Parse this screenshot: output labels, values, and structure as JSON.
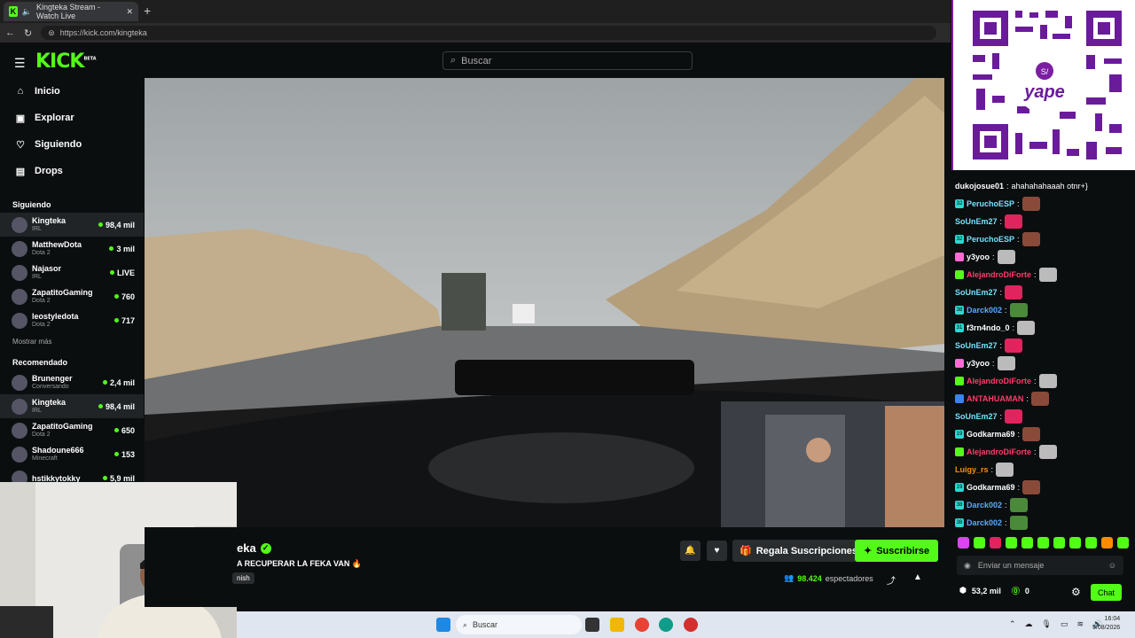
{
  "browser": {
    "tab_title": "Kingteka Stream - Watch Live",
    "url": "https://kick.com/kingteka",
    "new_tab": "+"
  },
  "header": {
    "logo": "KICK",
    "logo_badge": "BETA",
    "search_placeholder": "Buscar"
  },
  "sidebar": {
    "nav": [
      {
        "label": "Inicio",
        "icon": "home-icon"
      },
      {
        "label": "Explorar",
        "icon": "compass-icon"
      },
      {
        "label": "Siguiendo",
        "icon": "heart-icon"
      },
      {
        "label": "Drops",
        "icon": "drops-icon"
      }
    ],
    "following_title": "Siguiendo",
    "following": [
      {
        "name": "Kingteka",
        "category": "IRL",
        "viewers": "98,4 mil",
        "active": true
      },
      {
        "name": "MatthewDota",
        "category": "Dota 2",
        "viewers": "3 mil"
      },
      {
        "name": "Najasor",
        "category": "IRL",
        "viewers": "LIVE"
      },
      {
        "name": "ZapatitoGaming",
        "category": "Dota 2",
        "viewers": "760"
      },
      {
        "name": "leostyledota",
        "category": "Dota 2",
        "viewers": "717"
      }
    ],
    "show_more": "Mostrar más",
    "recommended_title": "Recomendado",
    "recommended": [
      {
        "name": "Brunenger",
        "category": "Conversando",
        "viewers": "2,4 mil"
      },
      {
        "name": "Kingteka",
        "category": "IRL",
        "viewers": "98,4 mil",
        "active": true
      },
      {
        "name": "ZapatitoGaming",
        "category": "Dota 2",
        "viewers": "650"
      },
      {
        "name": "Shadoune666",
        "category": "Minecraft",
        "viewers": "153"
      },
      {
        "name": "hstikkytokky",
        "category": "",
        "viewers": "5,9 mil"
      }
    ]
  },
  "stream": {
    "channel_name": "eka",
    "title": "A RECUPERAR LA FEKA VAN 🔥",
    "language_tag": "nish",
    "gift_label": "Regala Suscripciones",
    "subscribe_label": "Suscribirse",
    "viewers_count": "98.424",
    "viewers_label": "espectadores"
  },
  "chat": {
    "messages": [
      {
        "user": "dukojosue01",
        "text": "ahahahahaaah otnr+}",
        "color": "#ffffff",
        "badge": "",
        "emote": ""
      },
      {
        "user": "PeruchoESP",
        "text": "",
        "color": "#72e3ff",
        "badge": "32",
        "emote": "#8a4a3a"
      },
      {
        "user": "SoUnEm27",
        "text": "",
        "color": "#72e3ff",
        "badge": "",
        "emote": "#e0245e"
      },
      {
        "user": "PeruchoESP",
        "text": "",
        "color": "#72e3ff",
        "badge": "32",
        "emote": "#8a4a3a"
      },
      {
        "user": "y3yoo",
        "text": "",
        "color": "#ffffff",
        "badge": "pink",
        "emote": "#bbbbbb"
      },
      {
        "user": "AlejandroDiForte",
        "text": "",
        "color": "#ff3b6a",
        "badge": "green",
        "emote": "#bbbbbb"
      },
      {
        "user": "SoUnEm27",
        "text": "",
        "color": "#72e3ff",
        "badge": "",
        "emote": "#e0245e"
      },
      {
        "user": "Darck002",
        "text": "",
        "color": "#5aa9ff",
        "badge": "38",
        "emote": "#4a8a3a"
      },
      {
        "user": "f3rn4ndo_0",
        "text": "",
        "color": "#ffffff",
        "badge": "31",
        "emote": "#bbbbbb"
      },
      {
        "user": "SoUnEm27",
        "text": "",
        "color": "#72e3ff",
        "badge": "",
        "emote": "#e0245e"
      },
      {
        "user": "y3yoo",
        "text": "",
        "color": "#ffffff",
        "badge": "pink",
        "emote": "#bbbbbb"
      },
      {
        "user": "AlejandroDiForte",
        "text": "",
        "color": "#ff3b6a",
        "badge": "green",
        "emote": "#bbbbbb"
      },
      {
        "user": "ANTAHUAMAN",
        "text": "",
        "color": "#ff3b6a",
        "badge": "blue",
        "emote": "#8a4a3a"
      },
      {
        "user": "SoUnEm27",
        "text": "",
        "color": "#72e3ff",
        "badge": "",
        "emote": "#e0245e"
      },
      {
        "user": "Godkarma69",
        "text": "",
        "color": "#ffffff",
        "badge": "19",
        "emote": "#8a4a3a"
      },
      {
        "user": "AlejandroDiForte",
        "text": "",
        "color": "#ff3b6a",
        "badge": "green",
        "emote": "#bbbbbb"
      },
      {
        "user": "Luigy_rs",
        "text": "",
        "color": "#ff8c00",
        "badge": "",
        "emote": "#bbbbbb"
      },
      {
        "user": "Godkarma69",
        "text": "",
        "color": "#ffffff",
        "badge": "19",
        "emote": "#8a4a3a"
      },
      {
        "user": "Darck002",
        "text": "",
        "color": "#5aa9ff",
        "badge": "38",
        "emote": "#4a8a3a"
      },
      {
        "user": "Darck002",
        "text": "",
        "color": "#5aa9ff",
        "badge": "38",
        "emote": "#4a8a3a"
      }
    ],
    "emote_bar": [
      "#d946ef",
      "#53fc18",
      "#e0245e",
      "#53fc18",
      "#53fc18",
      "#53fc18",
      "#53fc18",
      "#53fc18",
      "#53fc18",
      "#ff8c00",
      "#53fc18"
    ],
    "input_placeholder": "Enviar un mensaje",
    "points": "53,2 mil",
    "kicks": "0",
    "chat_button": "Chat"
  },
  "qr": {
    "brand": "yape",
    "symbol": "S/"
  },
  "taskbar": {
    "search_placeholder": "Buscar",
    "time": "16:04",
    "date": "5/08/2026"
  },
  "colors": {
    "accent": "#53fc18",
    "background": "#0b0e0f"
  }
}
